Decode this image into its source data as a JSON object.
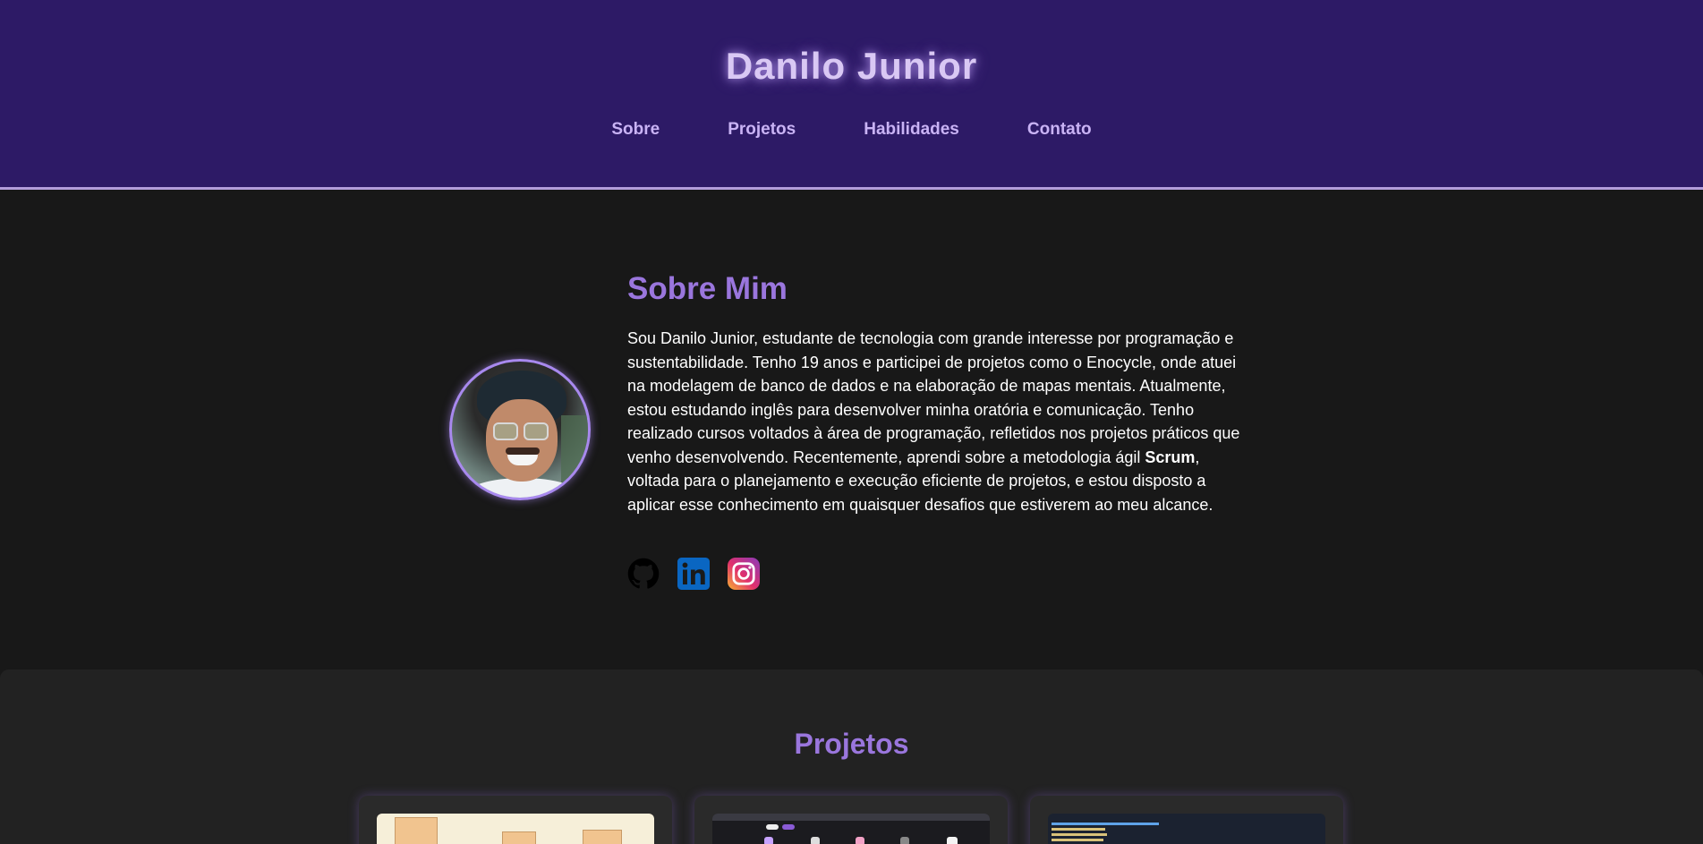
{
  "header": {
    "title": "Danilo Junior",
    "nav": [
      "Sobre",
      "Projetos",
      "Habilidades",
      "Contato"
    ]
  },
  "about": {
    "heading": "Sobre Mim",
    "text_before": "Sou Danilo Junior, estudante de tecnologia com grande interesse por programação e sustentabilidade. Tenho 19 anos e participei de projetos como o Enocycle, onde atuei na modelagem de banco de dados e na elaboração de mapas mentais. Atualmente, estou estudando inglês para desenvolver minha oratória e comunicação. Tenho realizado cursos voltados à área de programação, refletidos nos projetos práticos que venho desenvolvendo. Recentemente, aprendi sobre a metodologia ágil ",
    "text_bold": "Scrum",
    "text_after": ", voltada para o planejamento e execução eficiente de projetos, e estou disposto a aplicar esse conhecimento em quaisquer desafios que estiverem ao meu alcance.",
    "socials": [
      {
        "icon": "github-icon"
      },
      {
        "icon": "linkedin-icon",
        "color": "#0a66c2"
      },
      {
        "icon": "instagram-icon"
      }
    ]
  },
  "projects": {
    "heading": "Projetos"
  },
  "colors": {
    "header_bg": "#2d1a66",
    "accent": "#9a76dd",
    "page_bg": "#181818",
    "section_bg": "#222222"
  }
}
